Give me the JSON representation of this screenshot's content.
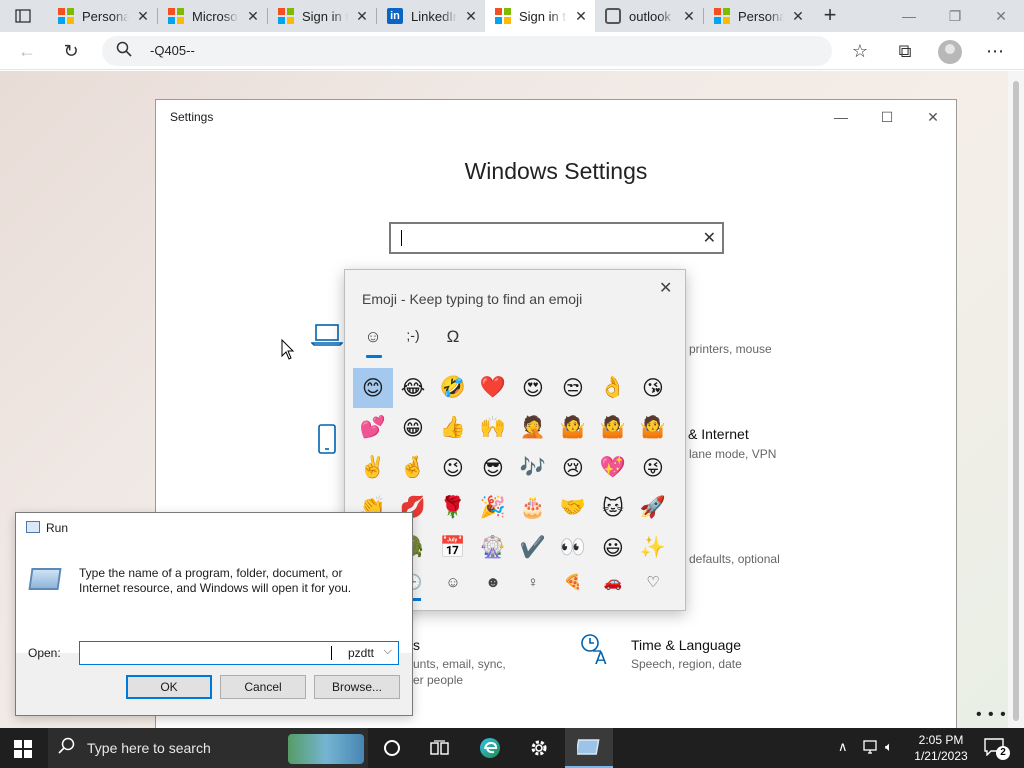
{
  "browser": {
    "tabs": [
      {
        "title": "Personal",
        "logo": "microsoft",
        "active": false
      },
      {
        "title": "Microsoft",
        "logo": "microsoft",
        "active": false
      },
      {
        "title": "Sign in to",
        "logo": "microsoft",
        "active": false
      },
      {
        "title": "LinkedIn",
        "logo": "linkedin",
        "active": false
      },
      {
        "title": "Sign in to",
        "logo": "microsoft",
        "active": true
      },
      {
        "title": "outlook",
        "logo": "outlook",
        "active": false
      },
      {
        "title": "Personal",
        "logo": "microsoft",
        "active": false
      }
    ],
    "address": "-Q405--"
  },
  "settings": {
    "window_title": "Settings",
    "heading": "Windows Settings",
    "categories": [
      {
        "icon": "laptop-icon",
        "title": "",
        "desc": "printers, mouse"
      },
      {
        "icon": "phone-icon",
        "title": "& Internet",
        "desc": "lane mode, VPN"
      },
      {
        "icon": "apps-icon",
        "title": "",
        "desc": "defaults, optional"
      },
      {
        "icon": "accounts-icon",
        "title": "s",
        "desc": "unts, email, sync,"
      },
      {
        "icon": "accounts-icon",
        "title": "",
        "desc": "er people"
      },
      {
        "icon": "time-language-icon",
        "title": "Time & Language",
        "desc": "Speech, region, date"
      }
    ]
  },
  "emoji_panel": {
    "title": "Emoji - Keep typing to find an emoji",
    "tabs": [
      "☺",
      ";-)",
      "Ω"
    ],
    "grid": [
      "😊",
      "😂",
      "🤣",
      "❤️",
      "😍",
      "😒",
      "👌",
      "😘",
      "💕",
      "😁",
      "👍",
      "🙌",
      "🤦",
      "🤷",
      "🤷",
      "🤷",
      "✌️",
      "🤞",
      "😉",
      "😎",
      "🎶",
      "😢",
      "💖",
      "😜",
      "👏",
      "💋",
      "🌹",
      "🎉",
      "🎂",
      "🤝",
      "🐱",
      "🚀",
      "🎁",
      "🐊",
      "📅",
      "🎡",
      "✔️",
      "👀",
      "😃",
      "✨"
    ],
    "categories": [
      "⌕",
      "🕒",
      "☺",
      "☻",
      "♀",
      "🍕",
      "🚗",
      "♡"
    ]
  },
  "run_dialog": {
    "title": "Run",
    "description": "Type the name of a program, folder, document, or Internet resource, and Windows will open it for you.",
    "open_label": "Open:",
    "open_value": "pzdtt",
    "ok": "OK",
    "cancel": "Cancel",
    "browse": "Browse..."
  },
  "taskbar": {
    "search_placeholder": "Type here to search",
    "time": "2:05 PM",
    "date": "1/21/2023",
    "notification_count": "2"
  },
  "colors": {
    "accent": "#0078d7",
    "settings_icon_blue": "#0063b1",
    "taskbar": "#1f1f1f"
  }
}
